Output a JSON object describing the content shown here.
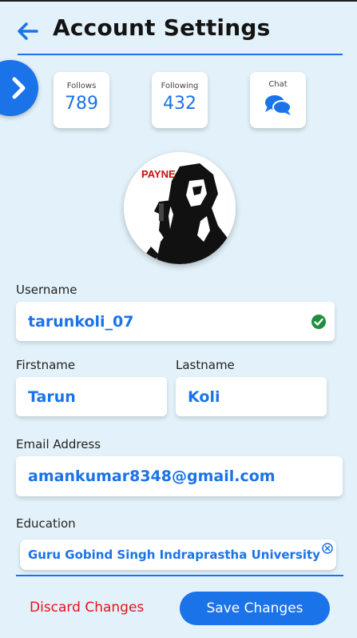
{
  "header": {
    "title": "Account Settings"
  },
  "stats": [
    {
      "label": "Follows",
      "value": "789"
    },
    {
      "label": "Following",
      "value": "432"
    },
    {
      "label": "Chat"
    }
  ],
  "avatar": {
    "caption": "PAYNE"
  },
  "form": {
    "username": {
      "label": "Username",
      "value": "tarunkoli_07",
      "status": "valid"
    },
    "firstname": {
      "label": "Firstname",
      "value": "Tarun"
    },
    "lastname": {
      "label": "Lastname",
      "value": "Koli"
    },
    "email": {
      "label": "Email Address",
      "value": "amankumar8348@gmail.com"
    },
    "education": {
      "label": "Education",
      "value": "Guru Gobind Singh Indraprastha University"
    }
  },
  "actions": {
    "discard": "Discard Changes",
    "save": "Save Changes"
  },
  "colors": {
    "accent": "#1a73e8",
    "danger": "#e8101a",
    "success": "#1e8e3e",
    "background": "#e3f2fa"
  }
}
